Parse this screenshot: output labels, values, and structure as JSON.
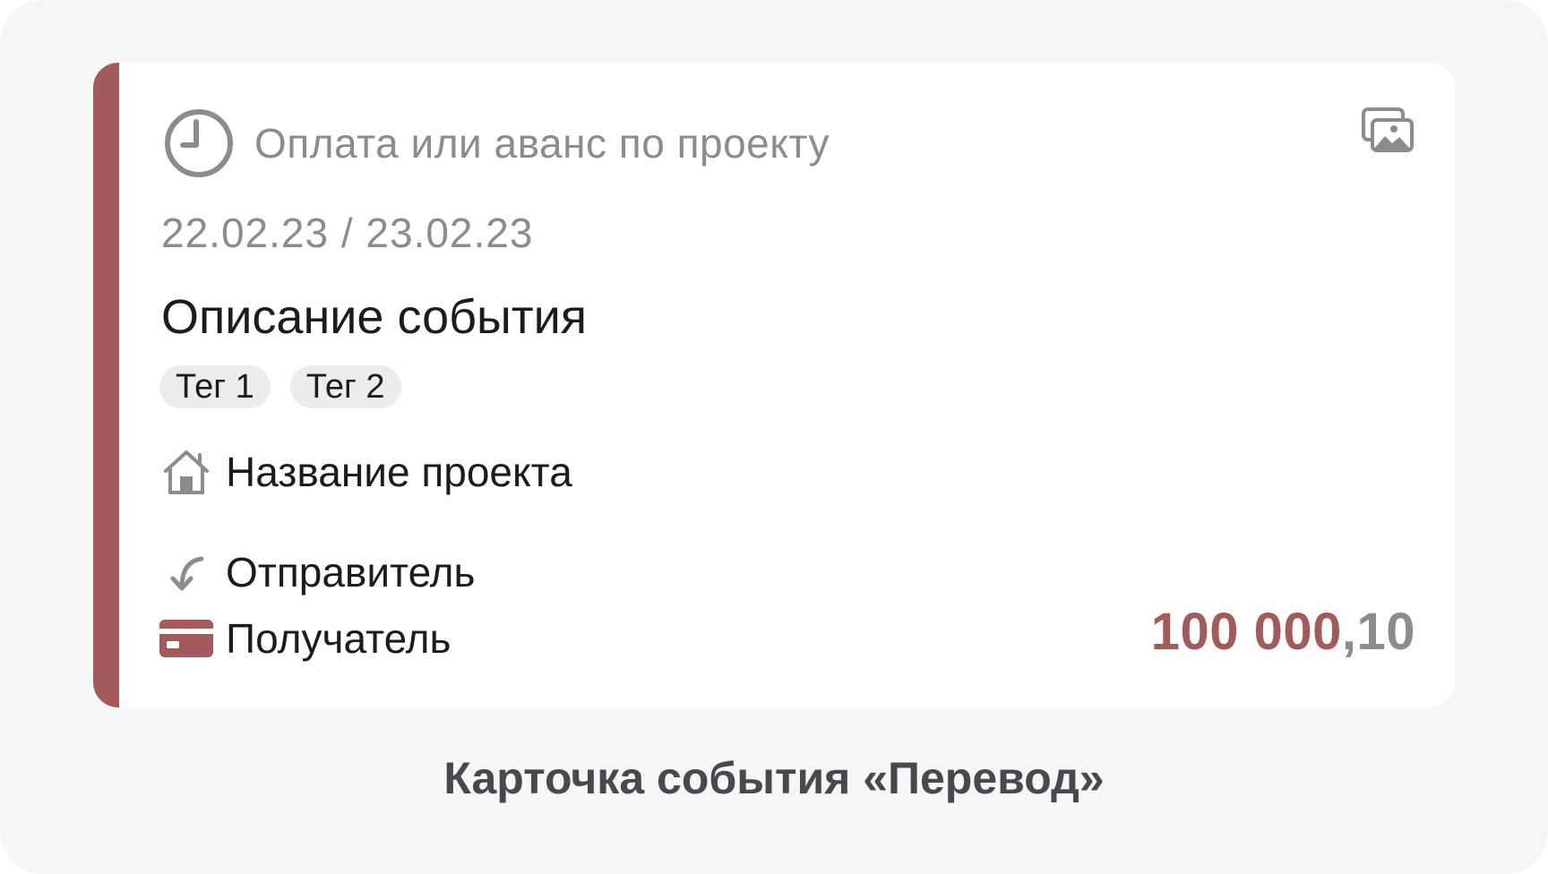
{
  "card": {
    "accent_color": "#a35a5b",
    "status_icon": "clock-icon",
    "status_text": "Оплата или аванс по проекту",
    "gallery_icon": "gallery-icon",
    "dates": "22.02.23 / 23.02.23",
    "title": "Описание события",
    "tags": [
      "Тег 1",
      "Тег 2"
    ],
    "project": {
      "icon": "home-icon",
      "name": "Название проекта"
    },
    "sender": {
      "icon": "incoming-arrow-icon",
      "label": "Отправитель"
    },
    "receiver": {
      "icon": "credit-card-icon",
      "label": "Получатель"
    },
    "amount": {
      "main": "100 000",
      "cents": ",10",
      "main_color": "#a35a5b",
      "cents_color": "#8b8c90"
    }
  },
  "caption": "Карточка события «Перевод»"
}
